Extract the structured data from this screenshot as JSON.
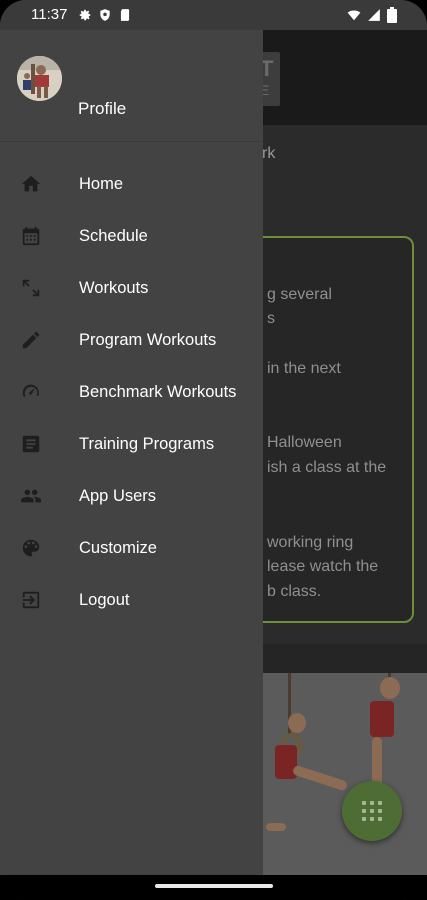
{
  "status_bar": {
    "time": "11:37",
    "left_icons": [
      "gear-icon",
      "shield-icon",
      "sd-card-icon"
    ],
    "right_icons": [
      "wifi-icon",
      "cell-signal-icon",
      "battery-icon"
    ]
  },
  "drawer": {
    "profile": {
      "label": "Profile"
    },
    "items": [
      {
        "label": "Home",
        "icon": "home-icon"
      },
      {
        "label": "Schedule",
        "icon": "calendar-icon"
      },
      {
        "label": "Workouts",
        "icon": "expand-arrows-icon"
      },
      {
        "label": "Program Workouts",
        "icon": "pencil-icon"
      },
      {
        "label": "Benchmark Workouts",
        "icon": "speedometer-icon"
      },
      {
        "label": "Training Programs",
        "icon": "document-icon"
      },
      {
        "label": "App Users",
        "icon": "people-icon"
      },
      {
        "label": "Customize",
        "icon": "palette-icon"
      },
      {
        "label": "Logout",
        "icon": "logout-icon"
      }
    ]
  },
  "background_page": {
    "logo_letters": [
      "T",
      "E"
    ],
    "section_label": "rk",
    "card_lines": [
      "g several",
      "s",
      "in the next",
      "Halloween",
      "ish a class at the",
      "working ring",
      "lease watch the",
      "b class."
    ],
    "fab_icon": "grid-icon"
  },
  "colors": {
    "drawer_bg": "#434343",
    "accent_green": "#6e8f3a",
    "fab_bg": "#4d6d34"
  }
}
